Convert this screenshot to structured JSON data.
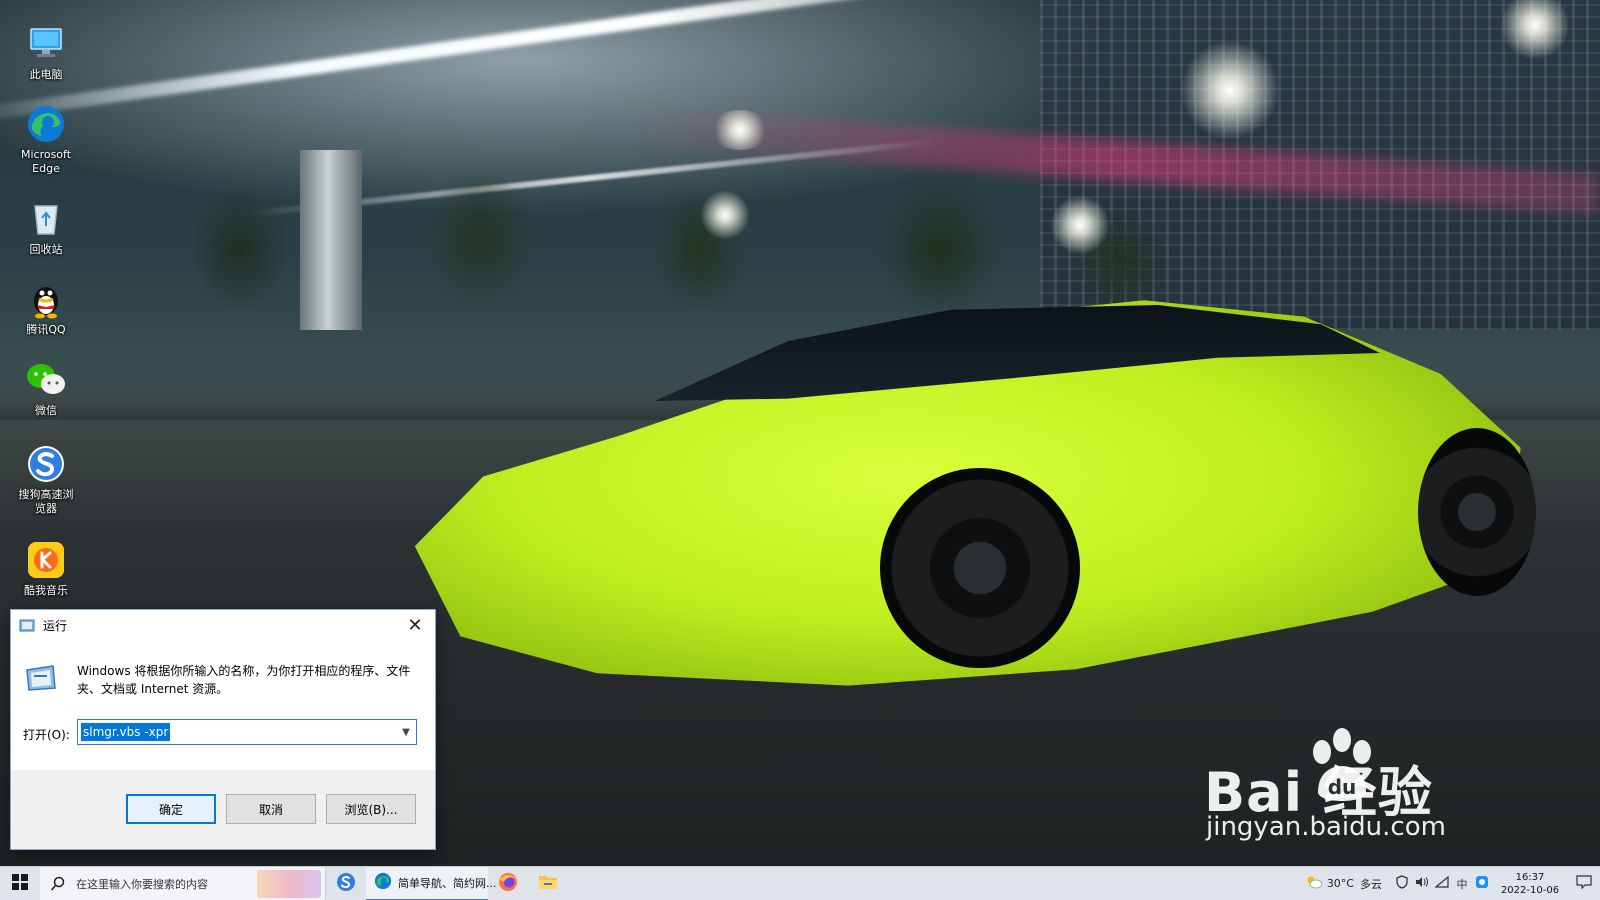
{
  "desktop": {
    "icons": [
      {
        "label": "此电脑",
        "icon": "computer-icon"
      },
      {
        "label": "Microsoft Edge",
        "icon": "edge-icon"
      },
      {
        "label": "回收站",
        "icon": "recycle-bin-icon"
      },
      {
        "label": "腾讯QQ",
        "icon": "qq-icon"
      },
      {
        "label": "微信",
        "icon": "wechat-icon"
      },
      {
        "label": "搜狗高速浏览器",
        "icon": "sogou-browser-icon"
      },
      {
        "label": "酷我音乐",
        "icon": "kuwo-music-icon"
      }
    ]
  },
  "run_dialog": {
    "title": "运行",
    "description": "Windows 将根据你所输入的名称，为你打开相应的程序、文件夹、文档或 Internet 资源。",
    "open_label": "打开(O):",
    "input_value": "slmgr.vbs -xpr",
    "ok_label": "确定",
    "cancel_label": "取消",
    "browse_label": "浏览(B)..."
  },
  "watermark": {
    "brand": "Bai  经验",
    "url": "jingyan.baidu.com"
  },
  "taskbar": {
    "search_placeholder": "在这里输入你要搜索的内容",
    "pinned": [
      "sogou-browser-icon",
      "edge-icon",
      "firefox-icon",
      "file-explorer-icon"
    ],
    "active_app_label": "简单导航、简约网...",
    "weather": {
      "temp": "30°C",
      "condition": "多云"
    },
    "tray_icons": [
      "security-icon",
      "volume-icon",
      "network-icon",
      "ime-icon",
      "qq-tray-icon"
    ],
    "ime_label": "中",
    "clock": {
      "time": "16:37",
      "date": "2022-10-06"
    }
  },
  "colors": {
    "accent": "#0078d7",
    "car": "#c6f21f",
    "taskbar": "#dfe3ea"
  }
}
